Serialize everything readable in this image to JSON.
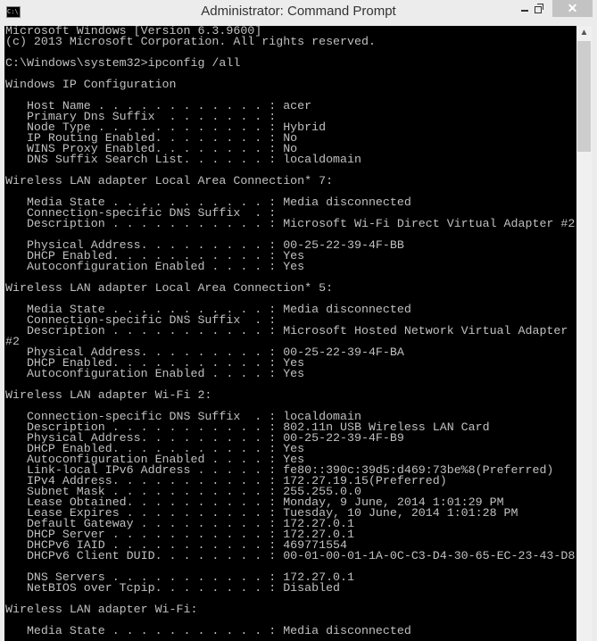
{
  "window": {
    "title": "Administrator: Command Prompt",
    "icon": "cmd-icon",
    "icon_text": "C:\\",
    "close_label": "✕"
  },
  "console": {
    "lines": [
      "Microsoft Windows [Version 6.3.9600]",
      "(c) 2013 Microsoft Corporation. All rights reserved.",
      "",
      "C:\\Windows\\system32>ipconfig /all",
      "",
      "Windows IP Configuration",
      "",
      "   Host Name . . . . . . . . . . . . : acer",
      "   Primary Dns Suffix  . . . . . . . :",
      "   Node Type . . . . . . . . . . . . : Hybrid",
      "   IP Routing Enabled. . . . . . . . : No",
      "   WINS Proxy Enabled. . . . . . . . : No",
      "   DNS Suffix Search List. . . . . . : localdomain",
      "",
      "Wireless LAN adapter Local Area Connection* 7:",
      "",
      "   Media State . . . . . . . . . . . : Media disconnected",
      "   Connection-specific DNS Suffix  . :",
      "   Description . . . . . . . . . . . : Microsoft Wi-Fi Direct Virtual Adapter #2",
      "",
      "   Physical Address. . . . . . . . . : 00-25-22-39-4F-BB",
      "   DHCP Enabled. . . . . . . . . . . : Yes",
      "   Autoconfiguration Enabled . . . . : Yes",
      "",
      "Wireless LAN adapter Local Area Connection* 5:",
      "",
      "   Media State . . . . . . . . . . . : Media disconnected",
      "   Connection-specific DNS Suffix  . :",
      "   Description . . . . . . . . . . . : Microsoft Hosted Network Virtual Adapter",
      "#2",
      "   Physical Address. . . . . . . . . : 00-25-22-39-4F-BA",
      "   DHCP Enabled. . . . . . . . . . . : Yes",
      "   Autoconfiguration Enabled . . . . : Yes",
      "",
      "Wireless LAN adapter Wi-Fi 2:",
      "",
      "   Connection-specific DNS Suffix  . : localdomain",
      "   Description . . . . . . . . . . . : 802.11n USB Wireless LAN Card",
      "   Physical Address. . . . . . . . . : 00-25-22-39-4F-B9",
      "   DHCP Enabled. . . . . . . . . . . : Yes",
      "   Autoconfiguration Enabled . . . . : Yes",
      "   Link-local IPv6 Address . . . . . : fe80::390c:39d5:d469:73be%8(Preferred)",
      "   IPv4 Address. . . . . . . . . . . : 172.27.19.15(Preferred)",
      "   Subnet Mask . . . . . . . . . . . : 255.255.0.0",
      "   Lease Obtained. . . . . . . . . . : Monday, 9 June, 2014 1:01:29 PM",
      "   Lease Expires . . . . . . . . . . : Tuesday, 10 June, 2014 1:01:28 PM",
      "   Default Gateway . . . . . . . . . : 172.27.0.1",
      "   DHCP Server . . . . . . . . . . . : 172.27.0.1",
      "   DHCPv6 IAID . . . . . . . . . . . : 469771554",
      "   DHCPv6 Client DUID. . . . . . . . : 00-01-00-01-1A-0C-C3-D4-30-65-EC-23-43-D8",
      "",
      "   DNS Servers . . . . . . . . . . . : 172.27.0.1",
      "   NetBIOS over Tcpip. . . . . . . . : Disabled",
      "",
      "Wireless LAN adapter Wi-Fi:",
      "",
      "   Media State . . . . . . . . . . . : Media disconnected"
    ]
  },
  "scrollbar": {
    "up_arrow": "▲"
  }
}
